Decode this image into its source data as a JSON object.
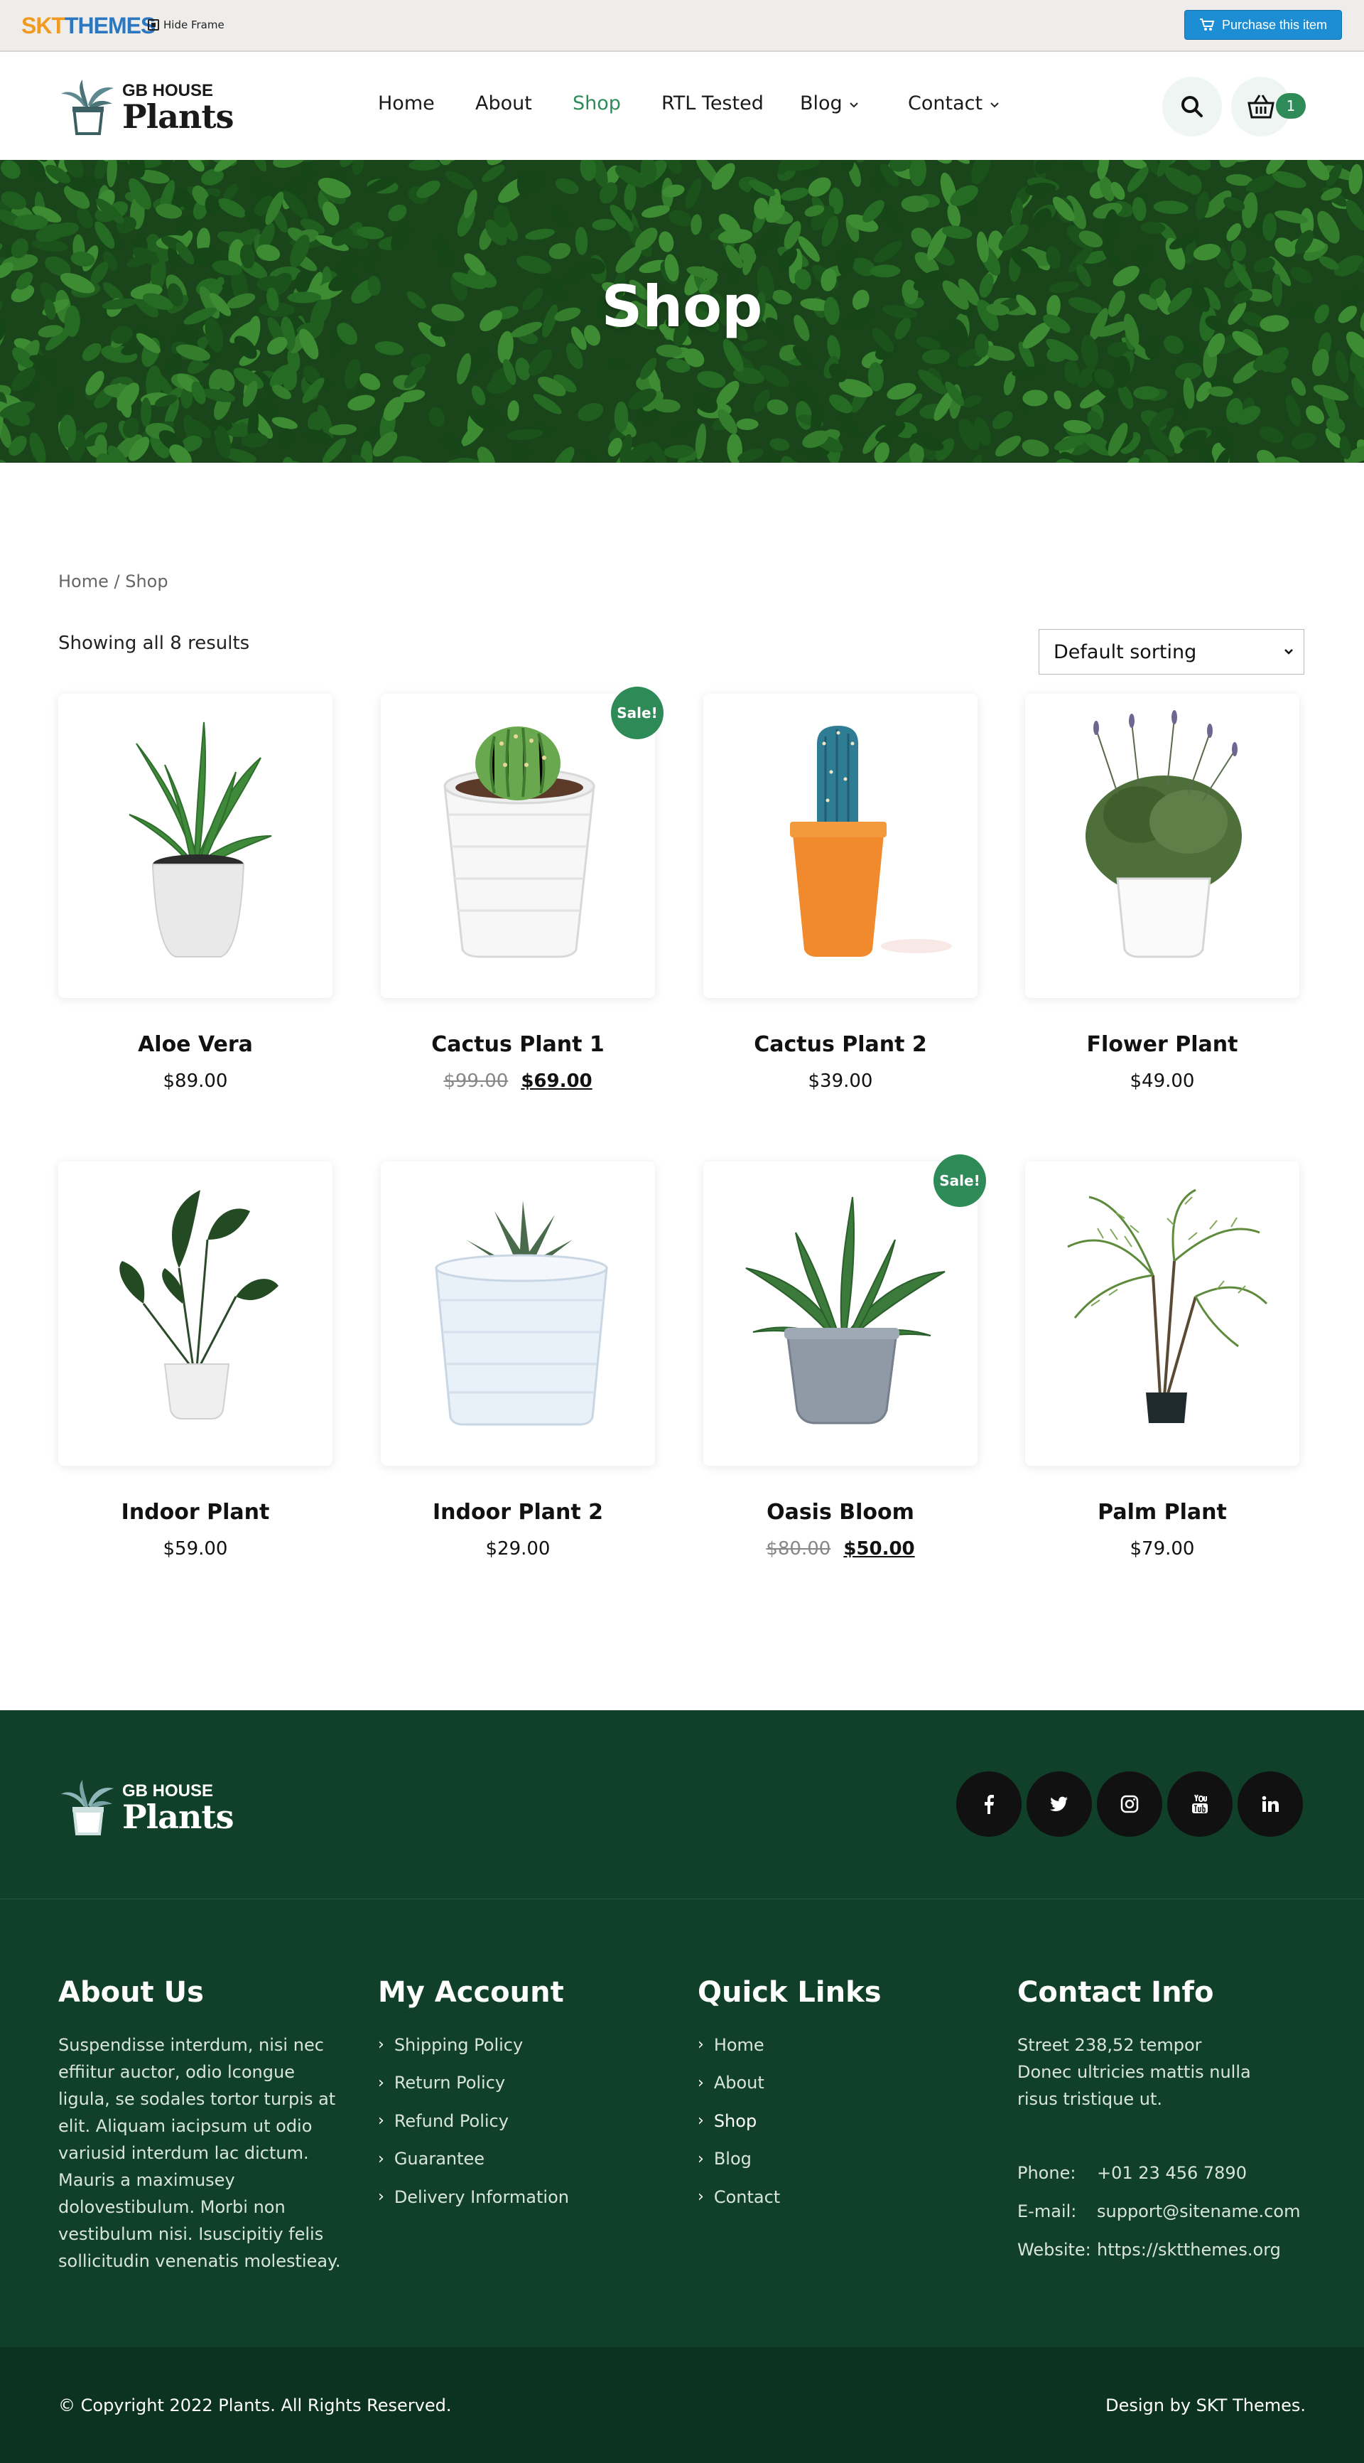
{
  "frame_bar": {
    "brand_a": "SKT",
    "brand_b": "THEMES",
    "hide_frame": "Hide Frame",
    "purchase": "Purchase this item"
  },
  "header": {
    "logo_line1": "GB HOUSE",
    "logo_line2": "Plants",
    "nav": [
      "Home",
      "About",
      "Shop",
      "RTL Tested",
      "Blog",
      "Contact"
    ],
    "active_nav": "Shop",
    "cart_count": "1"
  },
  "hero": {
    "title": "Shop"
  },
  "breadcrumb": {
    "home": "Home",
    "sep": " / ",
    "current": "Shop"
  },
  "toolbar": {
    "result_count": "Showing all 8 results",
    "sort_selected": "Default sorting"
  },
  "products": [
    {
      "name": "Aloe Vera",
      "price": "$89.00",
      "sale": false
    },
    {
      "name": "Cactus Plant 1",
      "old_price": "$99.00",
      "price": "$69.00",
      "sale": true
    },
    {
      "name": "Cactus Plant 2",
      "price": "$39.00",
      "sale": false
    },
    {
      "name": "Flower Plant",
      "price": "$49.00",
      "sale": false
    },
    {
      "name": "Indoor Plant",
      "price": "$59.00",
      "sale": false
    },
    {
      "name": "Indoor Plant 2",
      "price": "$29.00",
      "sale": false
    },
    {
      "name": "Oasis Bloom",
      "old_price": "$80.00",
      "price": "$50.00",
      "sale": true
    },
    {
      "name": "Palm Plant",
      "price": "$79.00",
      "sale": false
    }
  ],
  "sale_label": "Sale!",
  "footer": {
    "logo_line1": "GB HOUSE",
    "logo_line2": "Plants",
    "social": [
      "facebook-icon",
      "twitter-icon",
      "instagram-icon",
      "youtube-icon",
      "linkedin-icon"
    ],
    "about": {
      "title": "About Us",
      "text": "Suspendisse interdum, nisi nec effiitur auctor, odio lcongue ligula, se sodales tortor turpis at elit. Aliquam iacipsum ut odio variusid interdum lac dictum. Mauris a maximusey dolovestibulum. Morbi non vestibulum nisi. Isuscipitiy felis sollicitudin venenatis molestieay."
    },
    "account": {
      "title": "My Account",
      "links": [
        "Shipping Policy",
        "Return Policy",
        "Refund Policy",
        "Guarantee",
        "Delivery Information"
      ]
    },
    "quick": {
      "title": "Quick Links",
      "links": [
        "Home",
        "About",
        "Shop",
        "Blog",
        "Contact"
      ]
    },
    "contact": {
      "title": "Contact Info",
      "address": "Street 238,52 tempor Donec ultricies mattis nulla risus tristique ut.",
      "phone_label": "Phone:",
      "phone": "+01 23 456 7890",
      "email_label": "E-mail:",
      "email": "support@sitename.com",
      "website_label": "Website:",
      "website": "https://sktthemes.org"
    },
    "copyright": "© Copyright 2022 Plants. All Rights Reserved.",
    "design": "Design by SKT Themes."
  },
  "colors": {
    "accent": "#2e8b57",
    "footer_bg": "#10402a",
    "footer_bottom": "#0c3322",
    "purchase_blue": "#1d8ed4"
  }
}
